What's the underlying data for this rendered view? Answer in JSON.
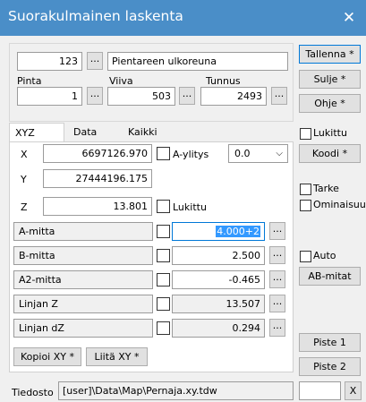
{
  "window": {
    "title": "Suorakulmainen laskenta",
    "close_glyph": "✕"
  },
  "top": {
    "number": "123",
    "description": "Pientareen ulkoreuna",
    "pinta_label": "Pinta",
    "viiva_label": "Viiva",
    "tunnus_label": "Tunnus",
    "pinta_value": "1",
    "viiva_value": "503",
    "tunnus_value": "2493"
  },
  "right_buttons": {
    "tallenna": "Tallenna *",
    "sulje": "Sulje *",
    "ohje": "Ohje *",
    "koodi": "Koodi *",
    "ab_mitat": "AB-mitat",
    "piste1": "Piste 1",
    "piste2": "Piste 2"
  },
  "right_checks": {
    "lukittu": "Lukittu",
    "tarke": "Tarke",
    "ominaisuus": "Ominaisuus",
    "auto": "Auto"
  },
  "tabs": [
    "XYZ",
    "Data",
    "Kaikki"
  ],
  "xyz": {
    "x_label": "X",
    "x_value": "6697126.970",
    "y_label": "Y",
    "y_value": "27444196.175",
    "z_label": "Z",
    "z_value": "13.801",
    "aylitys_label": "A-ylitys",
    "aylitys_value": "0.0",
    "lukittu_label": "Lukittu"
  },
  "measures": [
    {
      "label": "A-mitta",
      "value": "4.000+2"
    },
    {
      "label": "B-mitta",
      "value": "2.500"
    },
    {
      "label": "A2-mitta",
      "value": "-0.465"
    },
    {
      "label": "Linjan Z",
      "value": "13.507"
    },
    {
      "label": "Linjan dZ",
      "value": "0.294"
    }
  ],
  "bottom_buttons": {
    "kopioi": "Kopioi XY *",
    "liita": "Liitä XY *"
  },
  "file": {
    "label": "Tiedosto",
    "path": "[user]\\Data\\Map\\Pernaja.xy.tdw",
    "x_button": "X"
  },
  "glyphs": {
    "dots": "...",
    "chevron": "⌵"
  }
}
